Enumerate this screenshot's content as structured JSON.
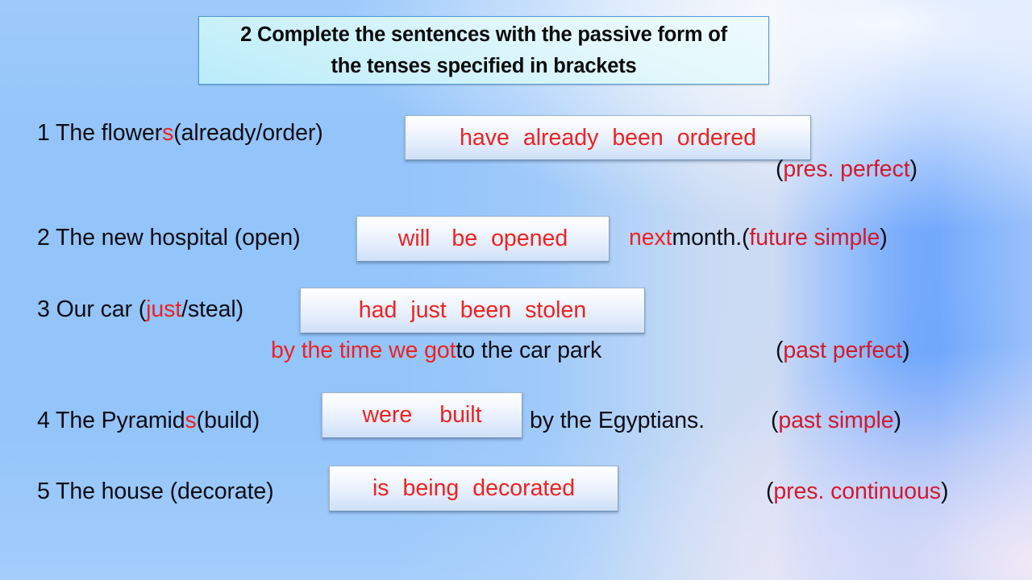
{
  "slide": {
    "background_colors": {
      "field_blue": "#93c4fa",
      "highlight_white": "#d7e0f2",
      "deep_blue_band": "#4f92fc",
      "lilac_corner": "#f3e7f5"
    },
    "title": {
      "number": "2",
      "line1": "2 Complete the sentences with the passive form of",
      "line2": "the tenses specified in brackets",
      "box_fill_top": "#eefbfd",
      "box_fill_bottom": "#b9ecfa",
      "box_border": "#4e9ad6",
      "text_color": "#0b0b0b"
    },
    "colors": {
      "answer_red": "#ee2222",
      "tag_red": "#d21a2e",
      "body_black": "#0d0d14",
      "answer_box_border": "#9fb4cc"
    },
    "exercises": [
      {
        "number": "1",
        "stem_a": "1 The flower",
        "stem_red": "s",
        "stem_b": " (already/order)",
        "answer_words": [
          "have",
          "already",
          "been",
          "ordered"
        ],
        "answer_full": "have already been ordered",
        "tail": "",
        "tense_open": "(",
        "tense_label": "pres. perfect",
        "tense_close": ")"
      },
      {
        "number": "2",
        "stem_a": "2 The new hospital (open)",
        "stem_red": "",
        "stem_b": "",
        "answer_words": [
          "will",
          "be",
          "opened"
        ],
        "answer_full": "will be opened",
        "tail_red": "next",
        "tail_black": " month. ",
        "tense_open": "(",
        "tense_label": "future simple",
        "tense_close": ")"
      },
      {
        "number": "3",
        "stem_a": "3 Our car (",
        "stem_red": "just",
        "stem_b": "/steal)",
        "answer_words": [
          "had",
          "just",
          "been",
          "stolen"
        ],
        "answer_full": "had just been stolen",
        "line2_red": "by the time we got",
        "line2_black": " to the car park",
        "tense_open": "(",
        "tense_label": "past perfect",
        "tense_close": ")"
      },
      {
        "number": "4",
        "stem_a": "4 The Pyramid",
        "stem_red": "s",
        "stem_b": " (build)",
        "answer_words": [
          "were",
          "built"
        ],
        "answer_full": "were built",
        "tail_black": "by the Egyptians.",
        "tense_open": "(",
        "tense_label": "past simple",
        "tense_close": ")"
      },
      {
        "number": "5",
        "stem_a": "5 The house (decorate)",
        "stem_red": "",
        "stem_b": "",
        "answer_words": [
          "is",
          "being",
          "decorated"
        ],
        "answer_full": "is being decorated",
        "tail": "",
        "tense_open": "(",
        "tense_label": "pres. continuous",
        "tense_close": ")"
      }
    ]
  }
}
